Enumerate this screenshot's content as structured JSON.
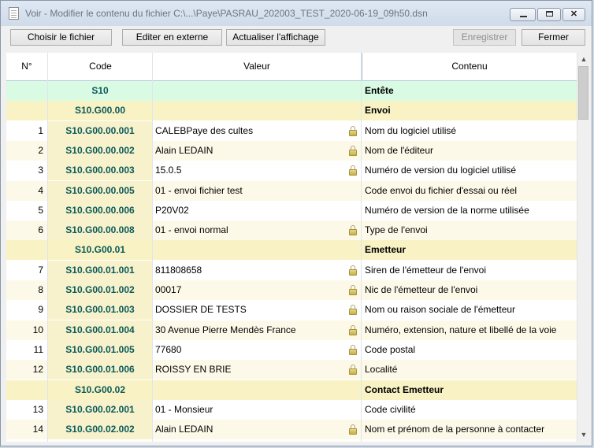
{
  "window": {
    "title": "Voir - Modifier le contenu du fichier C:\\...\\Paye\\PASRAU_202003_TEST_2020-06-19_09h50.dsn",
    "close_glyph": "✕"
  },
  "toolbar": {
    "choose_file": "Choisir le fichier",
    "edit_external": "Editer en externe",
    "refresh": "Actualiser l'affichage",
    "save": "Enregistrer",
    "close": "Fermer"
  },
  "columns": {
    "num": "N°",
    "code": "Code",
    "value": "Valeur",
    "content": "Contenu"
  },
  "scroll": {
    "up": "▲",
    "down": "▼"
  },
  "rows": [
    {
      "type": "section-top",
      "num": "",
      "code": "S10",
      "value": "",
      "content": "Entête",
      "locked": false
    },
    {
      "type": "section",
      "num": "",
      "code": "S10.G00.00",
      "value": "",
      "content": "Envoi",
      "locked": false
    },
    {
      "type": "data",
      "num": "1",
      "code": "S10.G00.00.001",
      "value": "CALEBPaye des cultes",
      "content": "Nom du logiciel utilisé",
      "locked": true
    },
    {
      "type": "data",
      "num": "2",
      "code": "S10.G00.00.002",
      "value": "Alain LEDAIN",
      "content": "Nom de l'éditeur",
      "locked": true
    },
    {
      "type": "data",
      "num": "3",
      "code": "S10.G00.00.003",
      "value": "15.0.5",
      "content": "Numéro de version du logiciel utilisé",
      "locked": true
    },
    {
      "type": "data",
      "num": "4",
      "code": "S10.G00.00.005",
      "value": "01 - envoi fichier test",
      "content": "Code envoi du fichier d'essai ou réel",
      "locked": false
    },
    {
      "type": "data",
      "num": "5",
      "code": "S10.G00.00.006",
      "value": "P20V02",
      "content": "Numéro de version de la norme utilisée",
      "locked": false
    },
    {
      "type": "data",
      "num": "6",
      "code": "S10.G00.00.008",
      "value": "01 - envoi normal",
      "content": "Type de l'envoi",
      "locked": true
    },
    {
      "type": "section",
      "num": "",
      "code": "S10.G00.01",
      "value": "",
      "content": "Emetteur",
      "locked": false
    },
    {
      "type": "data",
      "num": "7",
      "code": "S10.G00.01.001",
      "value": "811808658",
      "content": "Siren de l'émetteur de l'envoi",
      "locked": true
    },
    {
      "type": "data",
      "num": "8",
      "code": "S10.G00.01.002",
      "value": "00017",
      "content": "Nic de l'émetteur de l'envoi",
      "locked": true
    },
    {
      "type": "data",
      "num": "9",
      "code": "S10.G00.01.003",
      "value": "DOSSIER DE TESTS",
      "content": "Nom ou raison sociale de l'émetteur",
      "locked": true
    },
    {
      "type": "data",
      "num": "10",
      "code": "S10.G00.01.004",
      "value": "30 Avenue Pierre Mendès France",
      "content": "Numéro, extension, nature et libellé de la voie",
      "locked": true
    },
    {
      "type": "data",
      "num": "11",
      "code": "S10.G00.01.005",
      "value": "77680",
      "content": "Code postal",
      "locked": true
    },
    {
      "type": "data",
      "num": "12",
      "code": "S10.G00.01.006",
      "value": "ROISSY EN BRIE",
      "content": "Localité",
      "locked": true
    },
    {
      "type": "section",
      "num": "",
      "code": "S10.G00.02",
      "value": "",
      "content": "Contact Emetteur",
      "locked": false
    },
    {
      "type": "data",
      "num": "13",
      "code": "S10.G00.02.001",
      "value": "01 - Monsieur",
      "content": "Code civilité",
      "locked": false
    },
    {
      "type": "data",
      "num": "14",
      "code": "S10.G00.02.002",
      "value": "Alain LEDAIN",
      "content": "Nom et prénom de la personne à contacter",
      "locked": true
    }
  ]
}
